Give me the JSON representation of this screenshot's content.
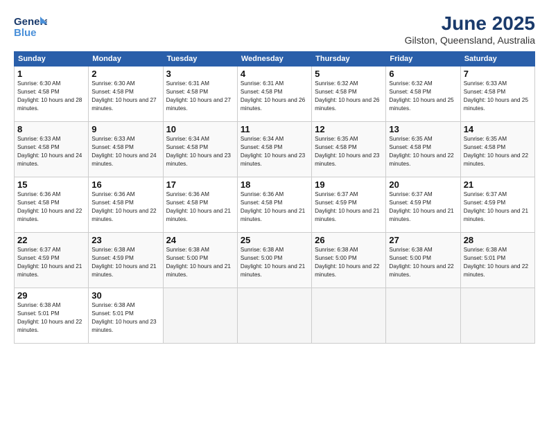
{
  "logo": {
    "line1": "General",
    "line2": "Blue"
  },
  "title": "June 2025",
  "subtitle": "Gilston, Queensland, Australia",
  "weekdays": [
    "Sunday",
    "Monday",
    "Tuesday",
    "Wednesday",
    "Thursday",
    "Friday",
    "Saturday"
  ],
  "weeks": [
    [
      {
        "day": "1",
        "sunrise": "6:30 AM",
        "sunset": "4:58 PM",
        "daylight": "10 hours and 28 minutes."
      },
      {
        "day": "2",
        "sunrise": "6:30 AM",
        "sunset": "4:58 PM",
        "daylight": "10 hours and 27 minutes."
      },
      {
        "day": "3",
        "sunrise": "6:31 AM",
        "sunset": "4:58 PM",
        "daylight": "10 hours and 27 minutes."
      },
      {
        "day": "4",
        "sunrise": "6:31 AM",
        "sunset": "4:58 PM",
        "daylight": "10 hours and 26 minutes."
      },
      {
        "day": "5",
        "sunrise": "6:32 AM",
        "sunset": "4:58 PM",
        "daylight": "10 hours and 26 minutes."
      },
      {
        "day": "6",
        "sunrise": "6:32 AM",
        "sunset": "4:58 PM",
        "daylight": "10 hours and 25 minutes."
      },
      {
        "day": "7",
        "sunrise": "6:33 AM",
        "sunset": "4:58 PM",
        "daylight": "10 hours and 25 minutes."
      }
    ],
    [
      {
        "day": "8",
        "sunrise": "6:33 AM",
        "sunset": "4:58 PM",
        "daylight": "10 hours and 24 minutes."
      },
      {
        "day": "9",
        "sunrise": "6:33 AM",
        "sunset": "4:58 PM",
        "daylight": "10 hours and 24 minutes."
      },
      {
        "day": "10",
        "sunrise": "6:34 AM",
        "sunset": "4:58 PM",
        "daylight": "10 hours and 23 minutes."
      },
      {
        "day": "11",
        "sunrise": "6:34 AM",
        "sunset": "4:58 PM",
        "daylight": "10 hours and 23 minutes."
      },
      {
        "day": "12",
        "sunrise": "6:35 AM",
        "sunset": "4:58 PM",
        "daylight": "10 hours and 23 minutes."
      },
      {
        "day": "13",
        "sunrise": "6:35 AM",
        "sunset": "4:58 PM",
        "daylight": "10 hours and 22 minutes."
      },
      {
        "day": "14",
        "sunrise": "6:35 AM",
        "sunset": "4:58 PM",
        "daylight": "10 hours and 22 minutes."
      }
    ],
    [
      {
        "day": "15",
        "sunrise": "6:36 AM",
        "sunset": "4:58 PM",
        "daylight": "10 hours and 22 minutes."
      },
      {
        "day": "16",
        "sunrise": "6:36 AM",
        "sunset": "4:58 PM",
        "daylight": "10 hours and 22 minutes."
      },
      {
        "day": "17",
        "sunrise": "6:36 AM",
        "sunset": "4:58 PM",
        "daylight": "10 hours and 21 minutes."
      },
      {
        "day": "18",
        "sunrise": "6:36 AM",
        "sunset": "4:58 PM",
        "daylight": "10 hours and 21 minutes."
      },
      {
        "day": "19",
        "sunrise": "6:37 AM",
        "sunset": "4:59 PM",
        "daylight": "10 hours and 21 minutes."
      },
      {
        "day": "20",
        "sunrise": "6:37 AM",
        "sunset": "4:59 PM",
        "daylight": "10 hours and 21 minutes."
      },
      {
        "day": "21",
        "sunrise": "6:37 AM",
        "sunset": "4:59 PM",
        "daylight": "10 hours and 21 minutes."
      }
    ],
    [
      {
        "day": "22",
        "sunrise": "6:37 AM",
        "sunset": "4:59 PM",
        "daylight": "10 hours and 21 minutes."
      },
      {
        "day": "23",
        "sunrise": "6:38 AM",
        "sunset": "4:59 PM",
        "daylight": "10 hours and 21 minutes."
      },
      {
        "day": "24",
        "sunrise": "6:38 AM",
        "sunset": "5:00 PM",
        "daylight": "10 hours and 21 minutes."
      },
      {
        "day": "25",
        "sunrise": "6:38 AM",
        "sunset": "5:00 PM",
        "daylight": "10 hours and 21 minutes."
      },
      {
        "day": "26",
        "sunrise": "6:38 AM",
        "sunset": "5:00 PM",
        "daylight": "10 hours and 22 minutes."
      },
      {
        "day": "27",
        "sunrise": "6:38 AM",
        "sunset": "5:00 PM",
        "daylight": "10 hours and 22 minutes."
      },
      {
        "day": "28",
        "sunrise": "6:38 AM",
        "sunset": "5:01 PM",
        "daylight": "10 hours and 22 minutes."
      }
    ],
    [
      {
        "day": "29",
        "sunrise": "6:38 AM",
        "sunset": "5:01 PM",
        "daylight": "10 hours and 22 minutes."
      },
      {
        "day": "30",
        "sunrise": "6:38 AM",
        "sunset": "5:01 PM",
        "daylight": "10 hours and 23 minutes."
      },
      null,
      null,
      null,
      null,
      null
    ]
  ],
  "labels": {
    "sunrise": "Sunrise:",
    "sunset": "Sunset:",
    "daylight": "Daylight:"
  }
}
